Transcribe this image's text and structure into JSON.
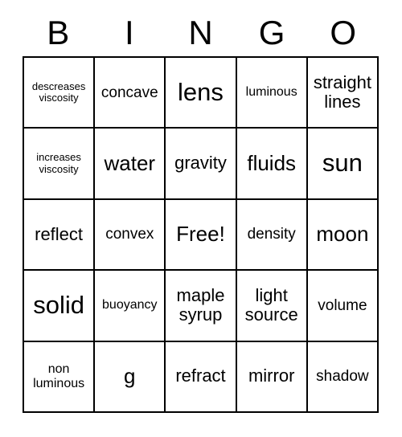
{
  "card": {
    "title_letters": [
      "B",
      "I",
      "N",
      "G",
      "O"
    ],
    "free_space_label": "Free!",
    "colors": {
      "text": "#000000",
      "border": "#000000",
      "background": "#ffffff"
    },
    "grid": {
      "rows": 5,
      "columns": 5,
      "cells": [
        [
          {
            "text": "descreases\nviscosity",
            "size": "fs-xs"
          },
          {
            "text": "concave",
            "size": "fs-m"
          },
          {
            "text": "lens",
            "size": "fs-xxl"
          },
          {
            "text": "luminous",
            "size": "fs-s"
          },
          {
            "text": "straight\nlines",
            "size": "fs-l"
          }
        ],
        [
          {
            "text": "increases\nviscosity",
            "size": "fs-xs"
          },
          {
            "text": "water",
            "size": "fs-xl"
          },
          {
            "text": "gravity",
            "size": "fs-l"
          },
          {
            "text": "fluids",
            "size": "fs-xl"
          },
          {
            "text": "sun",
            "size": "fs-xxl"
          }
        ],
        [
          {
            "text": "reflect",
            "size": "fs-l"
          },
          {
            "text": "convex",
            "size": "fs-m"
          },
          {
            "text": "Free!",
            "size": "fs-xl"
          },
          {
            "text": "density",
            "size": "fs-m"
          },
          {
            "text": "moon",
            "size": "fs-xl"
          }
        ],
        [
          {
            "text": "solid",
            "size": "fs-xxl"
          },
          {
            "text": "buoyancy",
            "size": "fs-s"
          },
          {
            "text": "maple\nsyrup",
            "size": "fs-l"
          },
          {
            "text": "light\nsource",
            "size": "fs-l"
          },
          {
            "text": "volume",
            "size": "fs-m"
          }
        ],
        [
          {
            "text": "non\nluminous",
            "size": "fs-s"
          },
          {
            "text": "g",
            "size": "fs-xl"
          },
          {
            "text": "refract",
            "size": "fs-l"
          },
          {
            "text": "mirror",
            "size": "fs-l"
          },
          {
            "text": "shadow",
            "size": "fs-m"
          }
        ]
      ]
    }
  }
}
